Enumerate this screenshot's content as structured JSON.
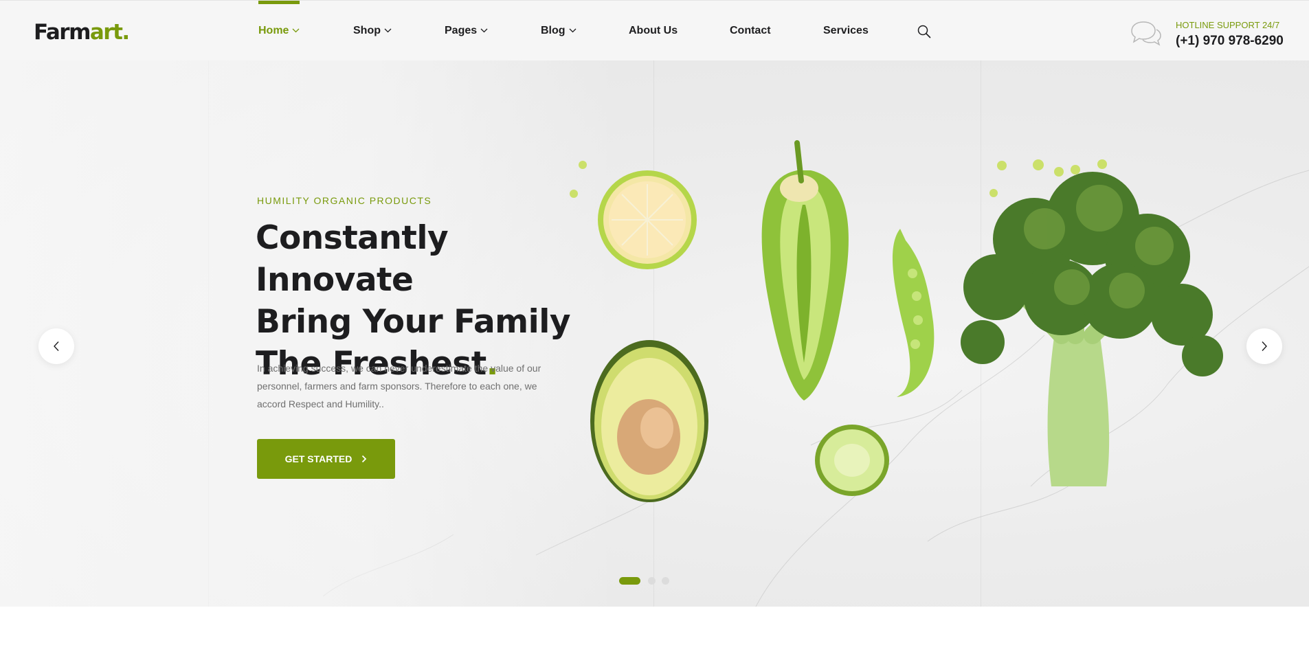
{
  "brand": {
    "name_part1": "Farm",
    "name_part2": "art",
    "name_dot": "."
  },
  "nav": {
    "items": [
      {
        "label": "Home",
        "has_dropdown": true,
        "active": true
      },
      {
        "label": "Shop",
        "has_dropdown": true
      },
      {
        "label": "Pages",
        "has_dropdown": true
      },
      {
        "label": "Blog",
        "has_dropdown": true
      },
      {
        "label": "About Us"
      },
      {
        "label": "Contact"
      },
      {
        "label": "Services"
      }
    ],
    "search_icon": "search-icon"
  },
  "hotline": {
    "label": "HOTLINE SUPPORT 24/7",
    "phone": "(+1) 970 978-6290",
    "icon": "chat-bubbles-icon"
  },
  "hero": {
    "eyebrow": "HUMILITY ORGANIC PRODUCTS",
    "headline_line1": "Constantly Innovate",
    "headline_line2": "Bring Your Family",
    "headline_line3": "The Freshest",
    "headline_dot": ".",
    "description": "In achieving success, we can never underestimate the value of our personnel, farmers and farm sponsors. Therefore to each one, we accord Respect and Humility..",
    "cta_label": "GET STARTED",
    "prev_icon": "chevron-left-icon",
    "next_icon": "chevron-right-icon",
    "slides_total": 3,
    "active_slide": 1
  },
  "colors": {
    "accent": "#799a0c",
    "text_dark": "#1d1d1f",
    "text_muted": "#6f6f6f",
    "header_bg": "#f6f6f6"
  }
}
